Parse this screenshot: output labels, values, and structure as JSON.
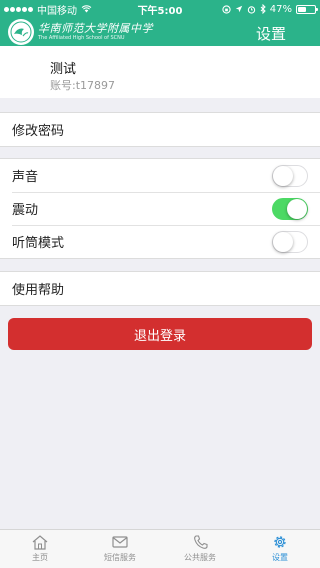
{
  "status_bar": {
    "carrier": "中国移动",
    "time": "下午5:00",
    "battery_text": "47%",
    "battery_level": 0.47
  },
  "nav": {
    "school_name_cn": "华南师范大学附属中学",
    "school_name_en": "The Affiliated High School of SCNU",
    "title": "设置"
  },
  "profile": {
    "name": "测试",
    "account": "账号:t17897"
  },
  "menu": {
    "change_password": "修改密码",
    "sound": "声音",
    "sound_on": false,
    "vibrate": "震动",
    "vibrate_on": true,
    "earpiece_mode": "听筒模式",
    "earpiece_on": false,
    "help": "使用帮助"
  },
  "logout_label": "退出登录",
  "tabs": [
    {
      "label": "主页",
      "icon": "home-icon",
      "active": false
    },
    {
      "label": "短信服务",
      "icon": "mail-icon",
      "active": false
    },
    {
      "label": "公共服务",
      "icon": "phone-icon",
      "active": false
    },
    {
      "label": "设置",
      "icon": "gear-icon",
      "active": true
    }
  ],
  "colors": {
    "brand": "#2bb38a",
    "toggle_on": "#4cd964",
    "logout": "#d32f2f",
    "tab_active": "#2b8fd6"
  }
}
